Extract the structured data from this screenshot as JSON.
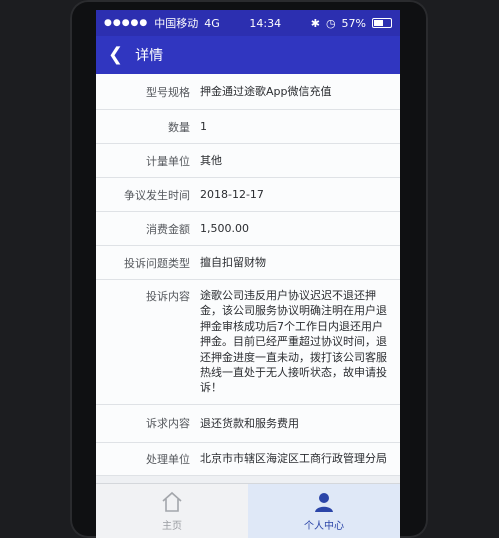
{
  "status": {
    "carrier": "中国移动",
    "network": "4G",
    "time": "14:34",
    "battery": "57%"
  },
  "nav": {
    "title": "详情"
  },
  "fields": [
    {
      "label": "型号规格",
      "value": "押金通过途歌App微信充值"
    },
    {
      "label": "数量",
      "value": "1"
    },
    {
      "label": "计量单位",
      "value": "其他"
    },
    {
      "label": "争议发生时间",
      "value": "2018-12-17"
    },
    {
      "label": "消费金额",
      "value": "1,500.00"
    },
    {
      "label": "投诉问题类型",
      "value": "擅自扣留财物"
    },
    {
      "label": "投诉内容",
      "value": "途歌公司违反用户协议迟迟不退还押金，该公司服务协议明确注明在用户退押金审核成功后7个工作日内退还用户押金。目前已经严重超过协议时间，退还押金进度一直未动，拨打该公司客服热线一直处于无人接听状态，故申请投诉！"
    },
    {
      "label": "诉求内容",
      "value": "退还货款和服务费用"
    },
    {
      "label": "处理单位",
      "value": "北京市市辖区海淀区工商行政管理分局"
    }
  ],
  "tabs": [
    {
      "label": "主页",
      "icon": "home-icon"
    },
    {
      "label": "个人中心",
      "icon": "user-icon"
    }
  ],
  "colors": {
    "accent": "#3036c0",
    "status_bar": "#2c2fb0",
    "active_tab": "#2b45a8"
  }
}
